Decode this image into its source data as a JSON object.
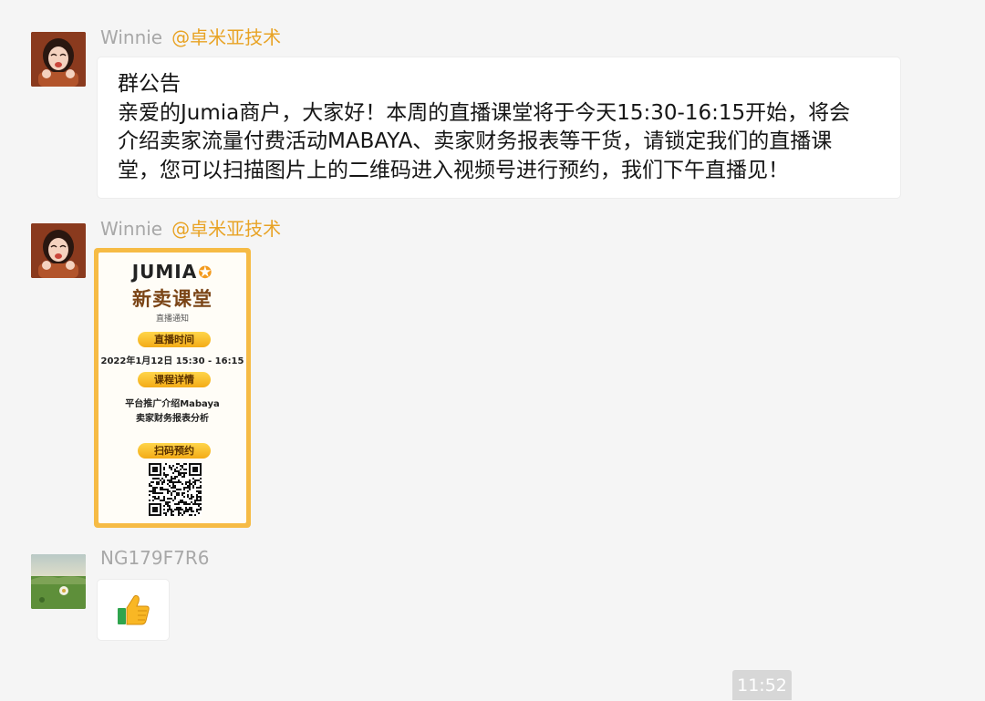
{
  "top_fragment": "",
  "messages": [
    {
      "sender": "Winnie",
      "tag": "@卓米亚技术",
      "lines": [
        "群公告",
        "亲爱的Jumia商户，大家好！本周的直播课堂将于今天15:30-16:15开始，将会",
        "介绍卖家流量付费活动MABAYA、卖家财务报表等干货，请锁定我们的直播课",
        "堂，您可以扫描图片上的二维码进入视频号进行预约，我们下午直播见！"
      ]
    },
    {
      "sender": "Winnie",
      "tag": "@卓米亚技术",
      "poster": {
        "brand": "JUMIA",
        "title": "新卖课堂",
        "subtitle": "直播通知",
        "pill_time": "直播时间",
        "time_text": "2022年1月12日 15:30 - 16:15",
        "pill_detail": "课程详情",
        "detail_1": "平台推广介绍Mabaya",
        "detail_2": "卖家财务报表分析",
        "pill_scan": "扫码预约"
      }
    },
    {
      "sender": "NG179F7R6",
      "tag": "",
      "emoji": "👍"
    }
  ],
  "timestamp": "11:52",
  "colors": {
    "background": "#f5f5f5",
    "sender_name": "#a8a8a8",
    "sender_tag": "#e8a325",
    "bubble": "#ffffff",
    "poster_frame": "#f6bb45",
    "time_chip": "#d7d7d7"
  },
  "icons": [
    "thumbs-up-icon",
    "qr-code-icon",
    "avatar-icon"
  ]
}
